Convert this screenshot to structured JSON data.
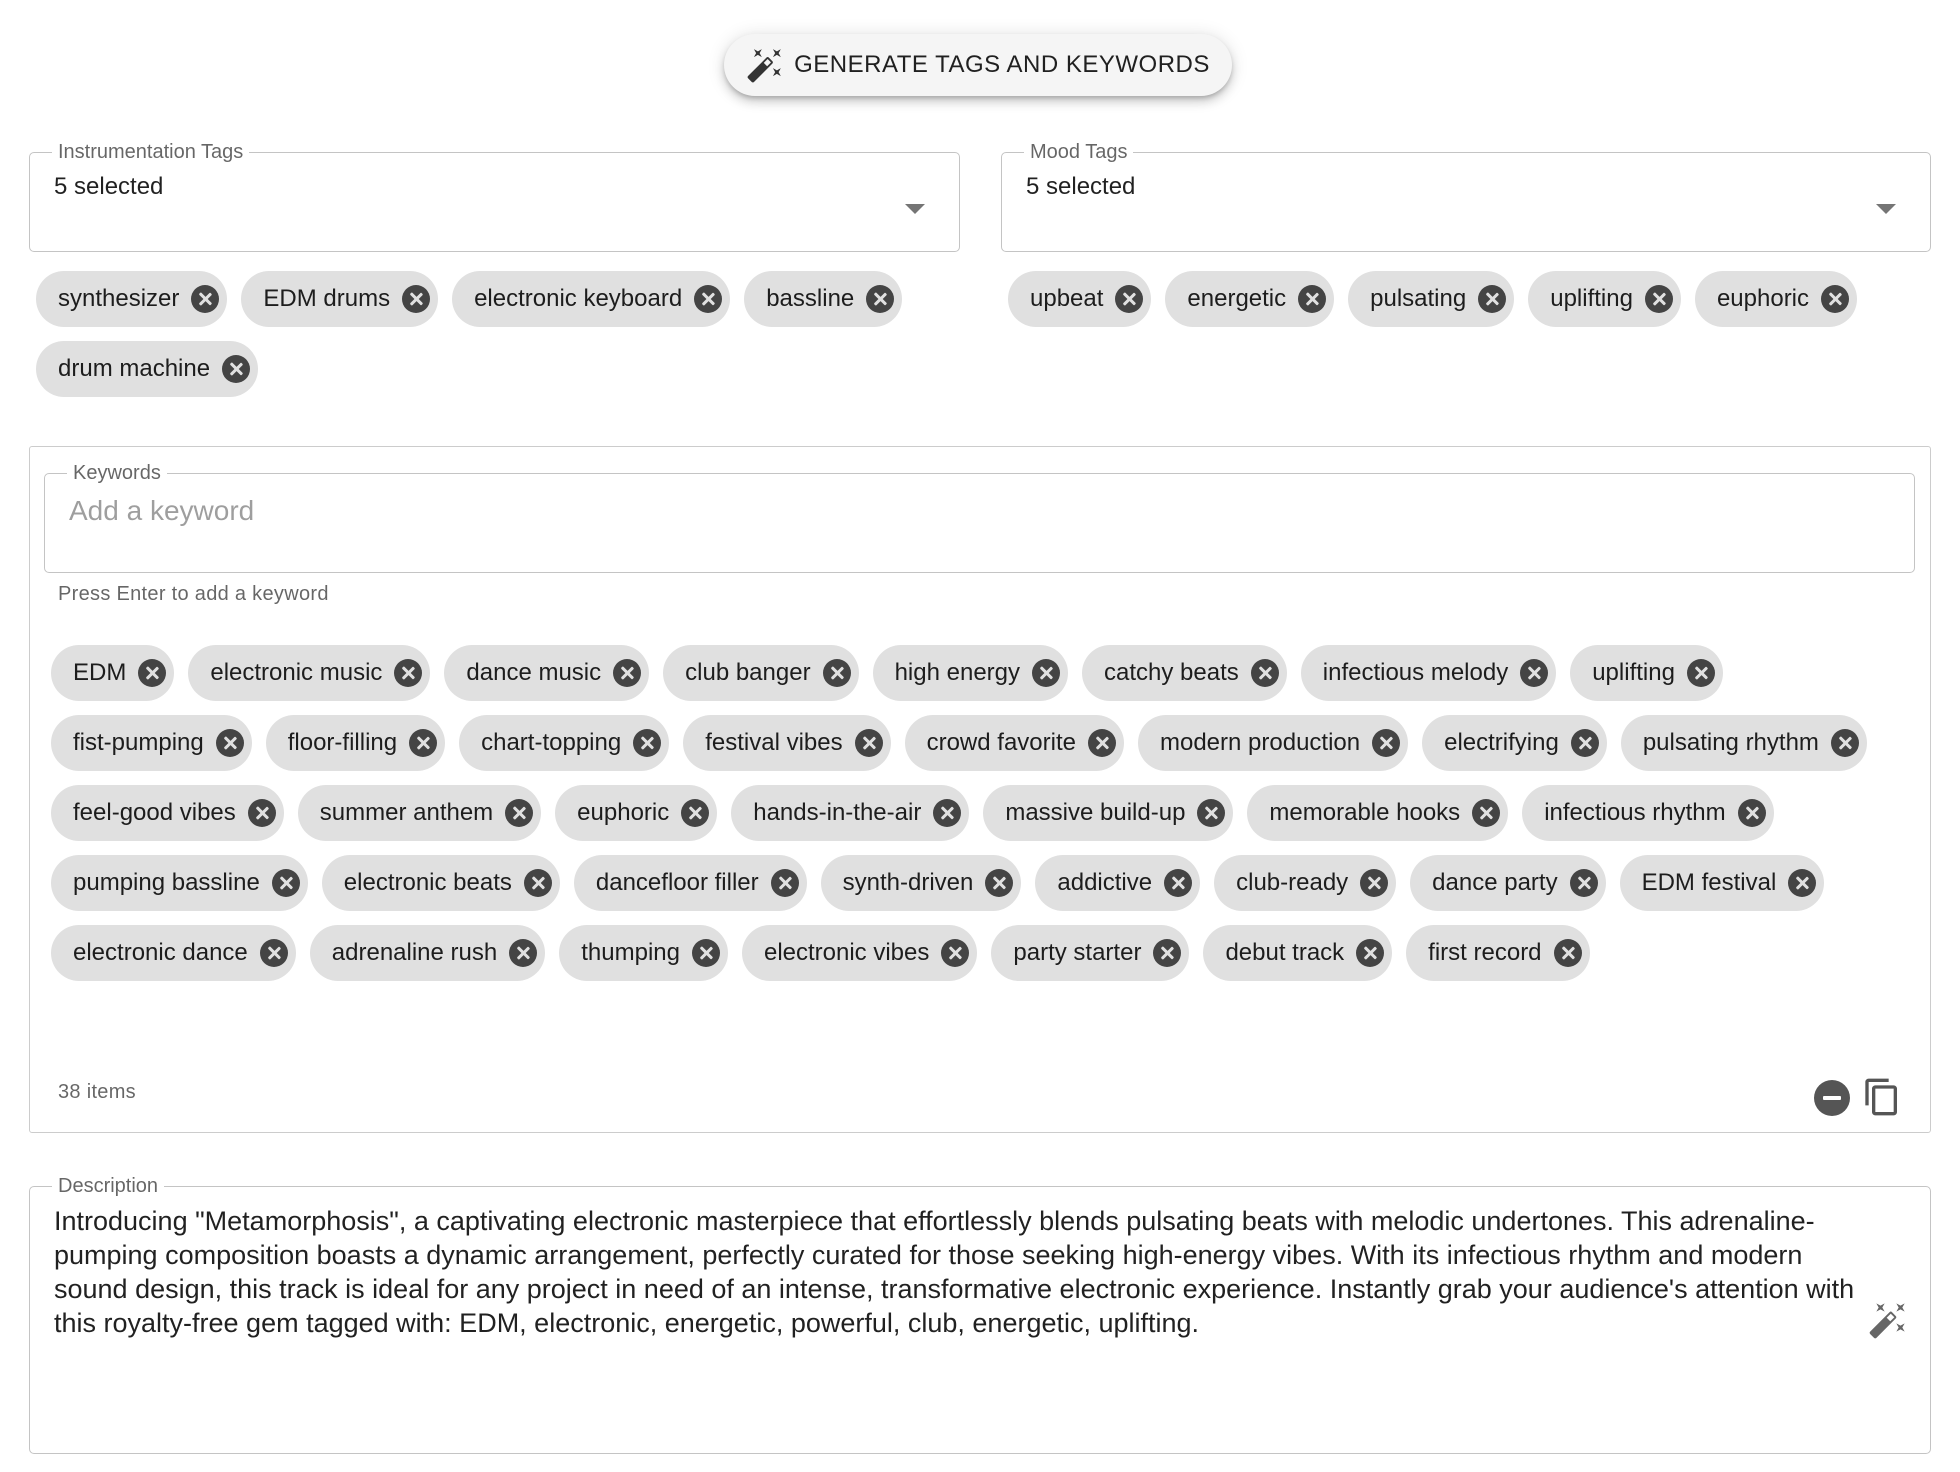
{
  "generate_button": {
    "label": "GENERATE TAGS AND KEYWORDS",
    "icon": "magic-wand-icon"
  },
  "instrumentation": {
    "label": "Instrumentation Tags",
    "value": "5 selected",
    "chips": [
      "synthesizer",
      "EDM drums",
      "electronic keyboard",
      "bassline",
      "drum machine"
    ]
  },
  "mood": {
    "label": "Mood Tags",
    "value": "5 selected",
    "chips": [
      "upbeat",
      "energetic",
      "pulsating",
      "uplifting",
      "euphoric"
    ]
  },
  "keywords": {
    "label": "Keywords",
    "placeholder": "Add a keyword",
    "helper": "Press Enter to add a keyword",
    "count": "38 items",
    "chips": [
      "EDM",
      "electronic music",
      "dance music",
      "club banger",
      "high energy",
      "catchy beats",
      "infectious melody",
      "uplifting",
      "fist-pumping",
      "floor-filling",
      "chart-topping",
      "festival vibes",
      "crowd favorite",
      "modern production",
      "electrifying",
      "pulsating rhythm",
      "feel-good vibes",
      "summer anthem",
      "euphoric",
      "hands-in-the-air",
      "massive build-up",
      "memorable hooks",
      "infectious rhythm",
      "pumping bassline",
      "electronic beats",
      "dancefloor filler",
      "synth-driven",
      "addictive",
      "club-ready",
      "dance party",
      "EDM festival",
      "electronic dance",
      "adrenaline rush",
      "thumping",
      "electronic vibes",
      "party starter",
      "debut track",
      "first record"
    ]
  },
  "description": {
    "label": "Description",
    "text": "Introducing \"Metamorphosis\", a captivating electronic masterpiece that effortlessly blends pulsating beats with melodic undertones. This adrenaline-pumping composition boasts a dynamic arrangement, perfectly curated for those seeking high-energy vibes. With its infectious rhythm and modern sound design, this track is ideal for any project in need of an intense, transformative electronic experience. Instantly grab your audience's attention with this royalty-free gem tagged with: EDM, electronic, energetic, powerful, club, energetic, uplifting."
  },
  "colors": {
    "chip_bg": "#e0e0e0",
    "chip_delete": "#444444",
    "border": "#c4c4c4"
  }
}
